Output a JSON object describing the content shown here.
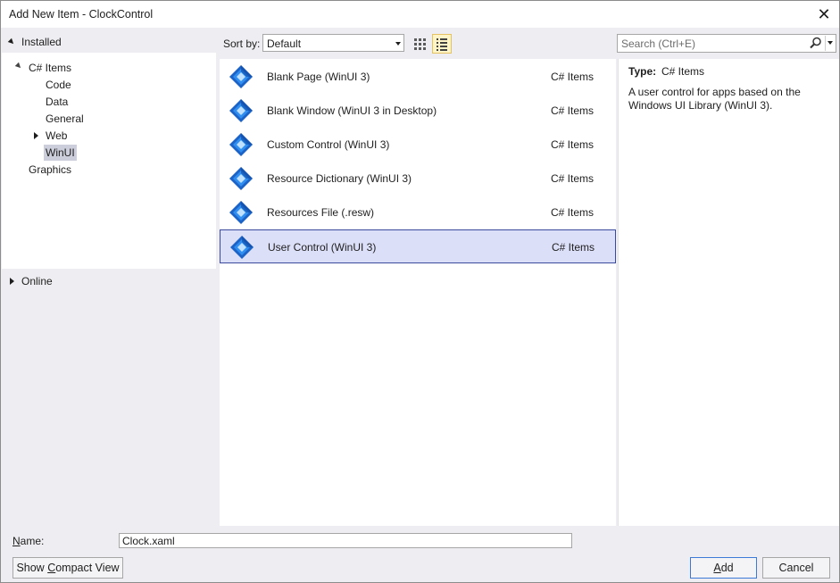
{
  "window": {
    "title": "Add New Item - ClockControl"
  },
  "left_panel": {
    "installed_label": "Installed",
    "tree": [
      {
        "label": "C# Items",
        "expanded": true
      },
      {
        "label": "Code"
      },
      {
        "label": "Data"
      },
      {
        "label": "General"
      },
      {
        "label": "Web",
        "collapsed": true
      },
      {
        "label": "WinUI",
        "selected": true
      },
      {
        "label": "Graphics"
      }
    ],
    "online_label": "Online"
  },
  "toolbar": {
    "sort_label": "Sort by:",
    "sort_value": "Default",
    "view_icons": [
      "grid-view-icon",
      "list-view-icon"
    ],
    "search_placeholder": "Search (Ctrl+E)"
  },
  "templates": [
    {
      "name": "Blank Page (WinUI 3)",
      "type": "C# Items"
    },
    {
      "name": "Blank Window (WinUI 3 in Desktop)",
      "type": "C# Items"
    },
    {
      "name": "Custom Control (WinUI 3)",
      "type": "C# Items"
    },
    {
      "name": "Resource Dictionary (WinUI 3)",
      "type": "C# Items"
    },
    {
      "name": "Resources File (.resw)",
      "type": "C# Items"
    },
    {
      "name": "User Control (WinUI 3)",
      "type": "C# Items",
      "selected": true
    }
  ],
  "details": {
    "type_label": "Type:",
    "type_value": "C# Items",
    "description": "A user control for apps based on the Windows UI Library (WinUI 3)."
  },
  "bottom": {
    "name_label_pre": "",
    "name_label_u": "N",
    "name_label_post": "ame:",
    "name_value": "Clock.xaml",
    "compact_pre": "Show ",
    "compact_u": "C",
    "compact_post": "ompact View",
    "add_u": "A",
    "add_post": "dd",
    "cancel_label": "Cancel"
  },
  "colors": {
    "selection_bg": "#dcdff8",
    "selection_border": "#3b4a9c",
    "tree_selection": "#cccedb",
    "accent_button_border": "#3d7ad8"
  }
}
